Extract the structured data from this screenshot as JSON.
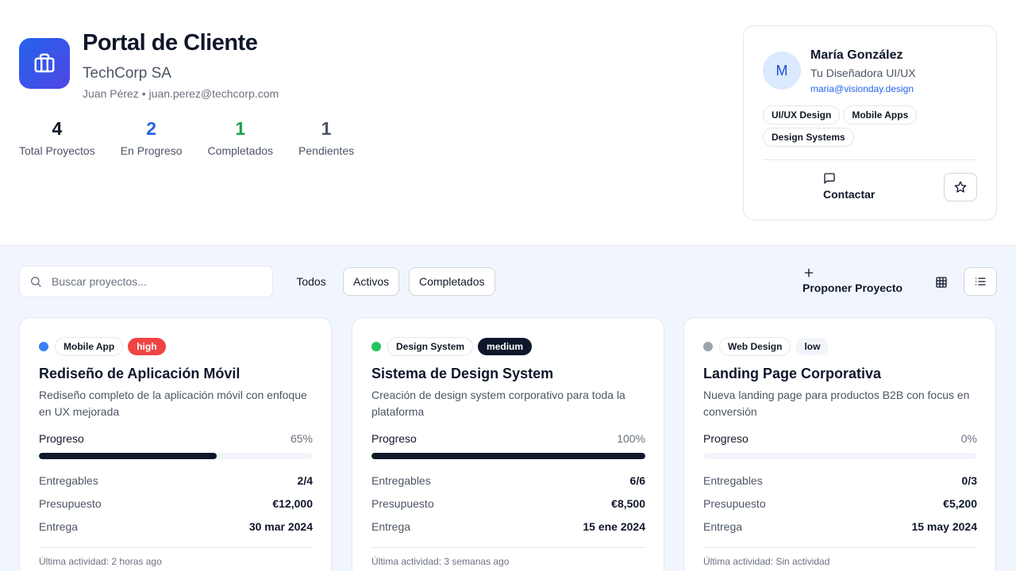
{
  "header": {
    "title": "Portal de Cliente",
    "company": "TechCorp SA",
    "user_name": "Juan Pérez",
    "user_sep": "•",
    "user_email": "juan.perez@techcorp.com",
    "stats": [
      {
        "value": "4",
        "label": "Total Proyectos",
        "color": "#0f172a"
      },
      {
        "value": "2",
        "label": "En Progreso",
        "color": "#2563eb"
      },
      {
        "value": "1",
        "label": "Completados",
        "color": "#16a34a"
      },
      {
        "value": "1",
        "label": "Pendientes",
        "color": "#4b5563"
      }
    ]
  },
  "designer": {
    "initial": "M",
    "name": "María González",
    "role": "Tu Diseñadora UI/UX",
    "email": "maria@visionday.design",
    "skills": [
      "UI/UX Design",
      "Mobile Apps",
      "Design Systems"
    ],
    "contact_label": "Contactar"
  },
  "toolbar": {
    "search_placeholder": "Buscar proyectos...",
    "filters": [
      "Todos",
      "Activos",
      "Completados"
    ],
    "propose_label": "Proponer Proyecto"
  },
  "projects": [
    {
      "status_color": "#3b82f6",
      "category": "Mobile App",
      "priority": "high",
      "priority_bg": "#ef4444",
      "priority_fg": "#ffffff",
      "title": "Rediseño de Aplicación Móvil",
      "description": "Rediseño completo de la aplicación móvil con enfoque en UX mejorada",
      "progress_label": "Progreso",
      "progress_text": "65%",
      "progress": 65,
      "deliverables_label": "Entregables",
      "deliverables": "2/4",
      "budget_label": "Presupuesto",
      "budget": "€12,000",
      "delivery_label": "Entrega",
      "delivery": "30 mar 2024",
      "activity": "Última actividad: 2 horas ago"
    },
    {
      "status_color": "#22c55e",
      "category": "Design System",
      "priority": "medium",
      "priority_bg": "#0f172a",
      "priority_fg": "#ffffff",
      "title": "Sistema de Design System",
      "description": "Creación de design system corporativo para toda la plataforma",
      "progress_label": "Progreso",
      "progress_text": "100%",
      "progress": 100,
      "deliverables_label": "Entregables",
      "deliverables": "6/6",
      "budget_label": "Presupuesto",
      "budget": "€8,500",
      "delivery_label": "Entrega",
      "delivery": "15 ene 2024",
      "activity": "Última actividad: 3 semanas ago"
    },
    {
      "status_color": "#9ca3af",
      "category": "Web Design",
      "priority": "low",
      "priority_bg": "#f1f5f9",
      "priority_fg": "#111827",
      "title": "Landing Page Corporativa",
      "description": "Nueva landing page para productos B2B con focus en conversión",
      "progress_label": "Progreso",
      "progress_text": "0%",
      "progress": 0,
      "deliverables_label": "Entregables",
      "deliverables": "0/3",
      "budget_label": "Presupuesto",
      "budget": "€5,200",
      "delivery_label": "Entrega",
      "delivery": "15 may 2024",
      "activity": "Última actividad: Sin actividad"
    }
  ]
}
